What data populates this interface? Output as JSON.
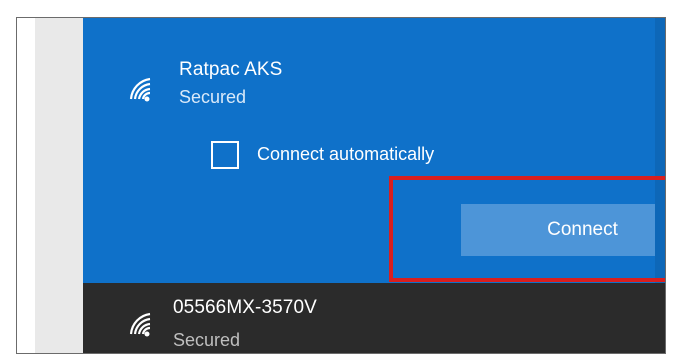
{
  "networks": [
    {
      "name": "Ratpac AKS",
      "status": "Secured",
      "selected": true,
      "connect_automatically_label": "Connect automatically",
      "connect_automatically_checked": false,
      "connect_button_label": "Connect"
    },
    {
      "name": "05566MX-3570V",
      "status": "Secured",
      "selected": false
    }
  ],
  "colors": {
    "selected_background": "#0f71c9",
    "button_background": "#4d95d8",
    "highlight_border": "#d81f1f",
    "unselected_background": "#2b2b2b"
  },
  "icons": {
    "network_icon": "wifi-secured-icon"
  }
}
